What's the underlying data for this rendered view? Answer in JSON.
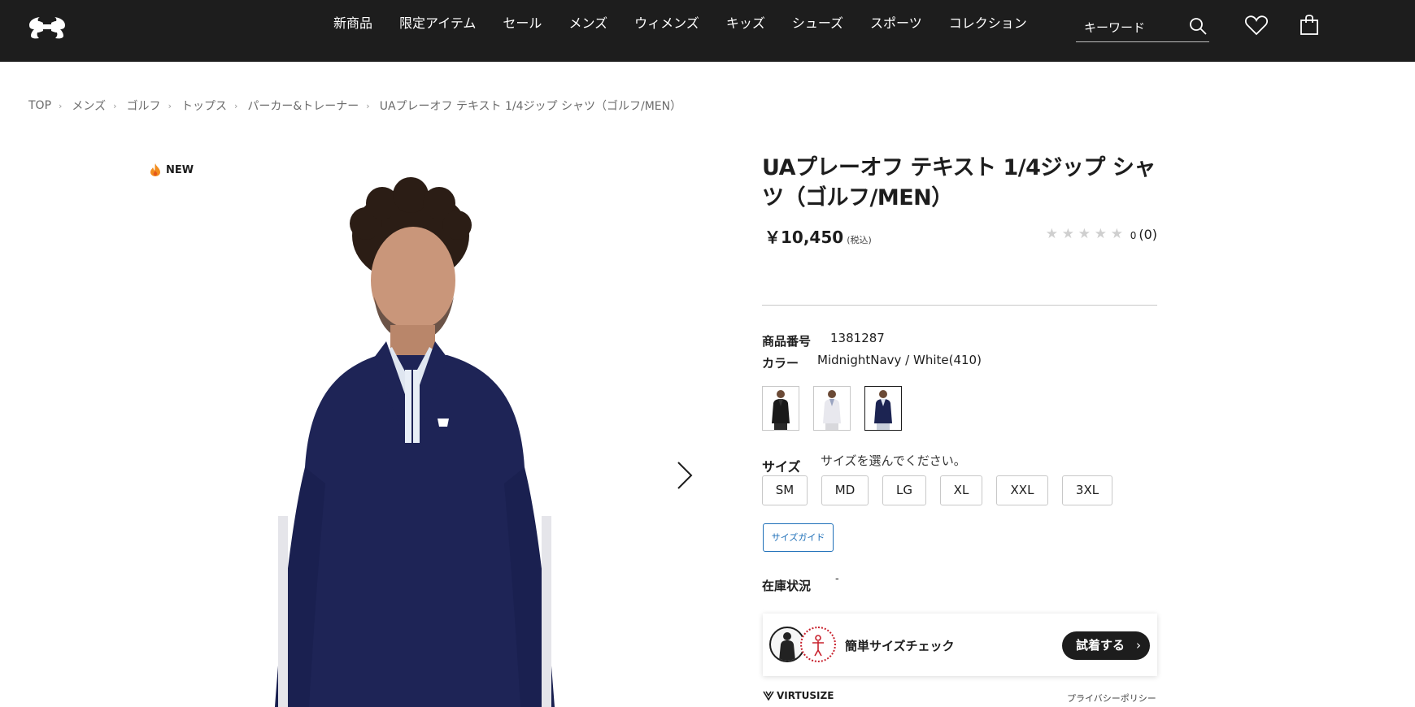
{
  "header": {
    "nav": [
      "新商品",
      "限定アイテム",
      "セール",
      "メンズ",
      "ウィメンズ",
      "キッズ",
      "シューズ",
      "スポーツ",
      "コレクション"
    ],
    "search_placeholder": "キーワード"
  },
  "breadcrumb": {
    "items": [
      "TOP",
      "メンズ",
      "ゴルフ",
      "トップス",
      "パーカー&トレーナー"
    ],
    "current": "UAプレーオフ テキスト 1/4ジップ シャツ（ゴルフ/MEN）"
  },
  "gallery": {
    "badge": "NEW"
  },
  "product": {
    "title": "UAプレーオフ テキスト 1/4ジップ シャツ（ゴルフ/MEN）",
    "price": "￥10,450",
    "tax_note": "(税込)",
    "rating_score": "0",
    "rating_count": "(0)",
    "product_number_label": "商品番号",
    "product_number": "1381287",
    "color_label": "カラー",
    "color_value": "MidnightNavy / White(410)",
    "swatches": [
      {
        "shirt": "#1a1a1a",
        "collar": "#333333",
        "pants": "#2a2a2a"
      },
      {
        "shirt": "#e8e8ee",
        "collar": "#9aa4c0",
        "pants": "#d8d8dc"
      },
      {
        "shirt": "#1c2452",
        "collar": "#dfe6f0",
        "pants": "#c9d0dc"
      }
    ],
    "selected_swatch": 2,
    "size_label": "サイズ",
    "size_hint": "サイズを選んでください。",
    "sizes": [
      "SM",
      "MD",
      "LG",
      "XL",
      "XXL",
      "3XL"
    ],
    "size_guide": "サイズガイド",
    "stock_label": "在庫状況",
    "stock_value": "-"
  },
  "virtusize": {
    "text": "簡単サイズチェック",
    "button": "試着する",
    "logo": "VIRTUSIZE",
    "privacy": "プライバシーポリシー"
  }
}
